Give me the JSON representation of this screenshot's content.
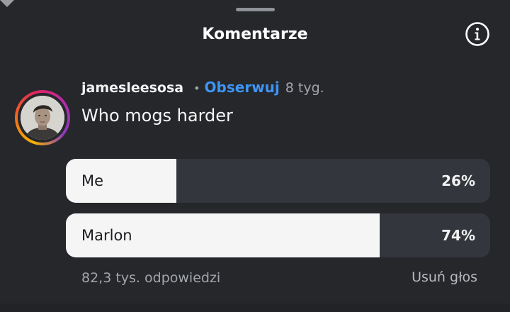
{
  "header": {
    "title": "Komentarze",
    "info_icon": "info-circle-icon"
  },
  "comment": {
    "username": "jamesleesosa",
    "separator": "•",
    "follow_label": "Obserwuj",
    "age": "8 tyg.",
    "text": "Who mogs harder",
    "avatar_icon": "profile-photo"
  },
  "poll": {
    "options": [
      {
        "label": "Me",
        "percent_label": "26%",
        "fraction": 0.26
      },
      {
        "label": "Marlon",
        "percent_label": "74%",
        "fraction": 0.74
      }
    ],
    "replies": "82,3 tys. odpowiedzi",
    "unvote_label": "Usuń głos"
  },
  "colors": {
    "background": "#25272b",
    "accent_link": "#3e95f5",
    "poll_fill": "#f5f5f5",
    "poll_track": "#33363c"
  }
}
